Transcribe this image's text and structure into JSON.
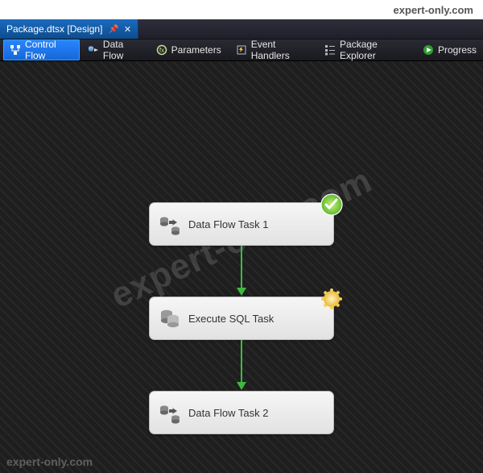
{
  "site": {
    "brand": "expert-only.com"
  },
  "tabbar": {
    "active": {
      "title": "Package.dtsx [Design]"
    }
  },
  "toolbar": {
    "items": [
      {
        "key": "control-flow",
        "label": "Control Flow",
        "icon": "control-flow-icon",
        "active": true
      },
      {
        "key": "data-flow",
        "label": "Data Flow",
        "icon": "data-flow-icon",
        "active": false
      },
      {
        "key": "parameters",
        "label": "Parameters",
        "icon": "parameters-icon",
        "active": false
      },
      {
        "key": "event-handlers",
        "label": "Event Handlers",
        "icon": "event-handlers-icon",
        "active": false
      },
      {
        "key": "package-explorer",
        "label": "Package Explorer",
        "icon": "package-explorer-icon",
        "active": false
      },
      {
        "key": "progress",
        "label": "Progress",
        "icon": "progress-icon",
        "active": false
      }
    ]
  },
  "flow": {
    "nodes": [
      {
        "id": "n1",
        "label": "Data Flow Task 1",
        "type": "data-flow-task",
        "status": "success"
      },
      {
        "id": "n2",
        "label": "Execute SQL Task",
        "type": "execute-sql-task",
        "status": "running"
      },
      {
        "id": "n3",
        "label": "Data Flow Task 2",
        "type": "data-flow-task",
        "status": "none"
      }
    ],
    "connectors": [
      {
        "from": "n1",
        "to": "n2",
        "color": "#3fb93f"
      },
      {
        "from": "n2",
        "to": "n3",
        "color": "#3fb93f"
      }
    ]
  },
  "watermark": {
    "main": "expert-only.com",
    "corner": "expert-only.com"
  }
}
